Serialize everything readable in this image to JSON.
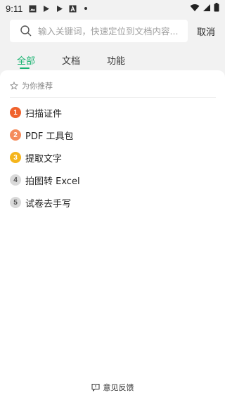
{
  "status_bar": {
    "time": "9:11",
    "icons": [
      "image-icon",
      "play-icon",
      "play-icon",
      "a-icon",
      "dot-icon"
    ],
    "right_icons": [
      "wifi-icon",
      "signal-icon",
      "battery-icon"
    ]
  },
  "search": {
    "placeholder": "输入关键词，快速定位到文档内容...",
    "cancel_label": "取消"
  },
  "tabs": [
    {
      "label": "全部",
      "active": true
    },
    {
      "label": "文档",
      "active": false
    },
    {
      "label": "功能",
      "active": false
    }
  ],
  "recommend": {
    "header": "为你推荐",
    "items": [
      {
        "rank": "1",
        "label": "扫描证件"
      },
      {
        "rank": "2",
        "label": "PDF 工具包"
      },
      {
        "rank": "3",
        "label": "提取文字"
      },
      {
        "rank": "4",
        "label": "拍图转 Excel"
      },
      {
        "rank": "5",
        "label": "试卷去手写"
      }
    ]
  },
  "feedback": {
    "label": "意见反馈"
  },
  "colors": {
    "accent": "#18b370",
    "rank1": "#f0622d",
    "rank2": "#f58b5b",
    "rank3": "#f5b51c",
    "rank_other": "#d9d9d9"
  }
}
